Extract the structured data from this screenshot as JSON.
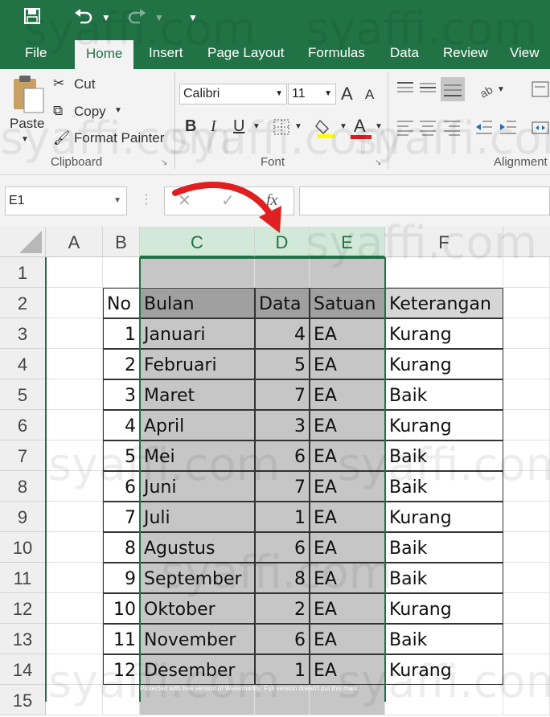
{
  "title_bar": {
    "save_icon": "save-icon",
    "undo_icon": "undo-icon",
    "redo_icon": "redo-icon",
    "customize_icon": "customize-qat-icon"
  },
  "tabs": [
    "File",
    "Home",
    "Insert",
    "Page Layout",
    "Formulas",
    "Data",
    "Review",
    "View"
  ],
  "active_tab": "Home",
  "clipboard": {
    "paste": "Paste",
    "cut": "Cut",
    "copy": "Copy",
    "format_painter": "Format Painter",
    "group": "Clipboard"
  },
  "font": {
    "family": "Calibri",
    "size": "11",
    "group": "Font",
    "bold": "B",
    "italic": "I",
    "underline": "U",
    "grow": "A",
    "shrink": "A",
    "font_color": "A"
  },
  "alignment": {
    "group": "Alignment"
  },
  "name_box": "E1",
  "formula_symbols": {
    "cancel": "✕",
    "enter": "✓",
    "fx": "fx"
  },
  "columns": [
    "A",
    "B",
    "C",
    "D",
    "E",
    "F"
  ],
  "rows": [
    "1",
    "2",
    "3",
    "4",
    "5",
    "6",
    "7",
    "8",
    "9",
    "10",
    "11",
    "12",
    "13",
    "14",
    "15"
  ],
  "table": {
    "headers": [
      "No",
      "Bulan",
      "Data",
      "Satuan",
      "Keterangan"
    ],
    "rows": [
      [
        "1",
        "Januari",
        "4",
        "EA",
        "Kurang"
      ],
      [
        "2",
        "Februari",
        "5",
        "EA",
        "Kurang"
      ],
      [
        "3",
        "Maret",
        "7",
        "EA",
        "Baik"
      ],
      [
        "4",
        "April",
        "3",
        "EA",
        "Kurang"
      ],
      [
        "5",
        "Mei",
        "6",
        "EA",
        "Baik"
      ],
      [
        "6",
        "Juni",
        "7",
        "EA",
        "Baik"
      ],
      [
        "7",
        "Juli",
        "1",
        "EA",
        "Kurang"
      ],
      [
        "8",
        "Agustus",
        "6",
        "EA",
        "Baik"
      ],
      [
        "9",
        "September",
        "8",
        "EA",
        "Baik"
      ],
      [
        "10",
        "Oktober",
        "2",
        "EA",
        "Kurang"
      ],
      [
        "11",
        "November",
        "6",
        "EA",
        "Baik"
      ],
      [
        "12",
        "Desember",
        "1",
        "EA",
        "Kurang"
      ]
    ]
  },
  "watermark": "syaffi.com",
  "footer_notice": "Protected with free version of Watermarkly. Full version doesn't put this mark.",
  "colors": {
    "excel_green": "#217346",
    "selection_gray": "#c6c6c6",
    "header_gray": "#a6a6a6",
    "arrow_red": "#e02020"
  }
}
